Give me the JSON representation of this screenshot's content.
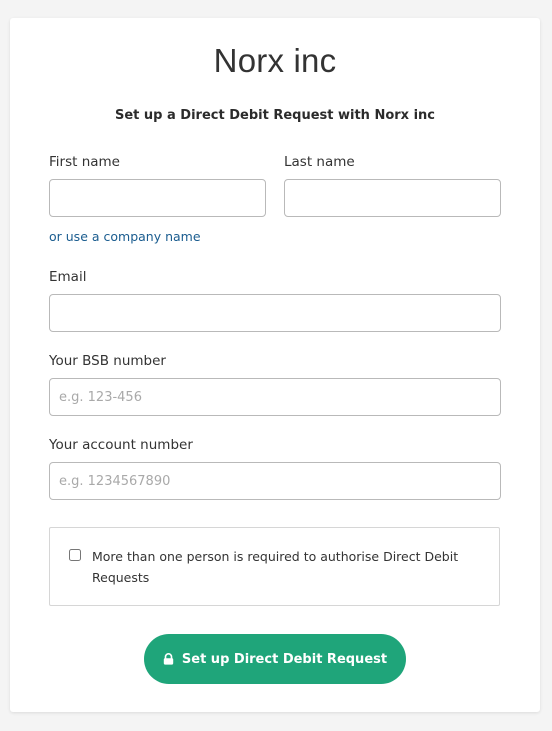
{
  "merchant": {
    "name": "Norx inc"
  },
  "form": {
    "subtitle": "Set up a Direct Debit Request with Norx inc",
    "first_name_label": "First name",
    "first_name_value": "",
    "last_name_label": "Last name",
    "last_name_value": "",
    "company_link": "or use a company name",
    "email_label": "Email",
    "email_value": "",
    "bsb_label": "Your BSB number",
    "bsb_placeholder": "e.g. 123-456",
    "account_label": "Your account number",
    "account_placeholder": "e.g. 1234567890",
    "multi_auth_text": "More than one person is required to authorise Direct Debit Requests",
    "multi_auth_checked": false,
    "submit_label": "Set up Direct Debit Request"
  },
  "icons": {
    "submit_icon": "lock-icon"
  },
  "colors": {
    "accent": "#1fa57a",
    "link": "#1a5c8f",
    "background": "#f4f4f4"
  }
}
